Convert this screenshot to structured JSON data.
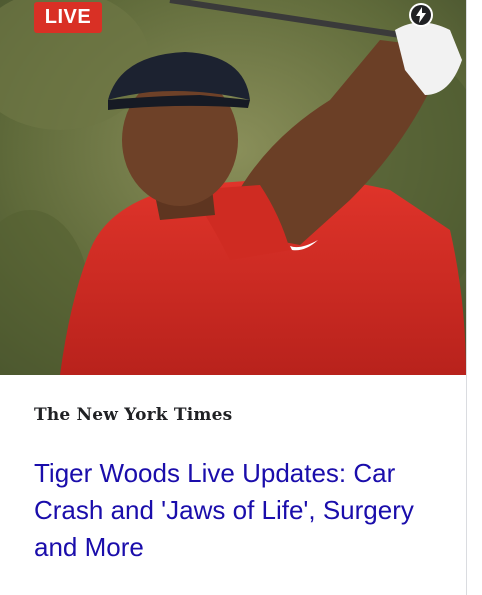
{
  "badge": {
    "label": "LIVE"
  },
  "amp_icon": "lightning-bolt-icon",
  "photo": {
    "subject": "golfer-photo"
  },
  "publisher": {
    "name": "The New York Times"
  },
  "headline": {
    "text": "Tiger Woods Live Updates: Car Crash and 'Jaws of Life', Surgery and More"
  },
  "colors": {
    "badge_bg": "#d93025",
    "headline": "#1a0dab",
    "publisher": "#202124"
  }
}
